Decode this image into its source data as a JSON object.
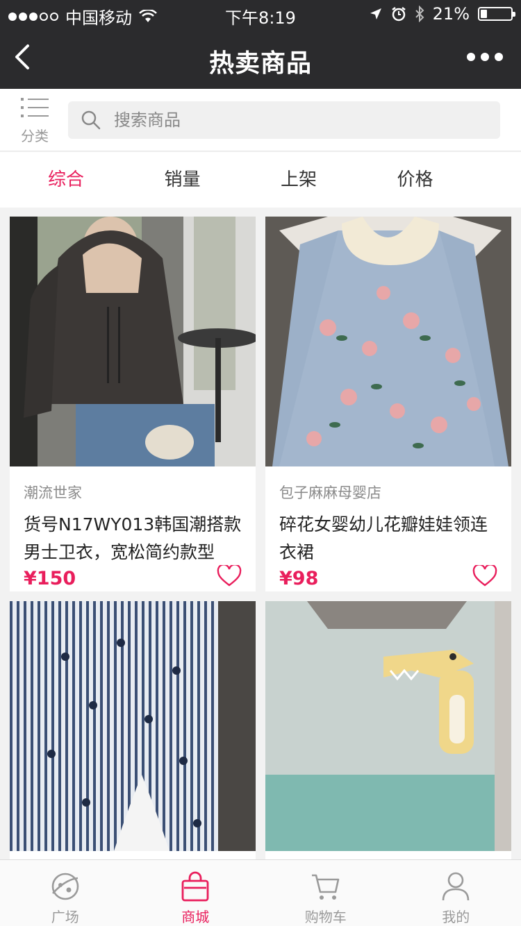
{
  "status_bar": {
    "carrier": "中国移动",
    "time": "下午8:19",
    "battery": "21%"
  },
  "nav": {
    "title": "热卖商品"
  },
  "search": {
    "category_label": "分类",
    "placeholder": "搜索商品"
  },
  "sort_tabs": [
    {
      "label": "综合"
    },
    {
      "label": "销量"
    },
    {
      "label": "上架"
    },
    {
      "label": "价格"
    }
  ],
  "products": [
    {
      "shop": "潮流世家",
      "title": "货号N17WY013韩国潮搭款男士卫衣，宽松简约款型",
      "price": "¥150"
    },
    {
      "shop": "包子麻麻母婴店",
      "title": "碎花女婴幼儿花瓣娃娃领连衣裙",
      "price": "¥98"
    },
    {
      "shop": "",
      "title": "",
      "price": ""
    },
    {
      "shop": "",
      "title": "",
      "price": ""
    }
  ],
  "tabbar": [
    {
      "label": "广场",
      "icon": "planet-icon"
    },
    {
      "label": "商城",
      "icon": "shopping-bag-icon"
    },
    {
      "label": "购物车",
      "icon": "cart-icon"
    },
    {
      "label": "我的",
      "icon": "user-icon"
    }
  ],
  "colors": {
    "accent": "#e91e5c",
    "topbar": "#2b2b2d"
  }
}
